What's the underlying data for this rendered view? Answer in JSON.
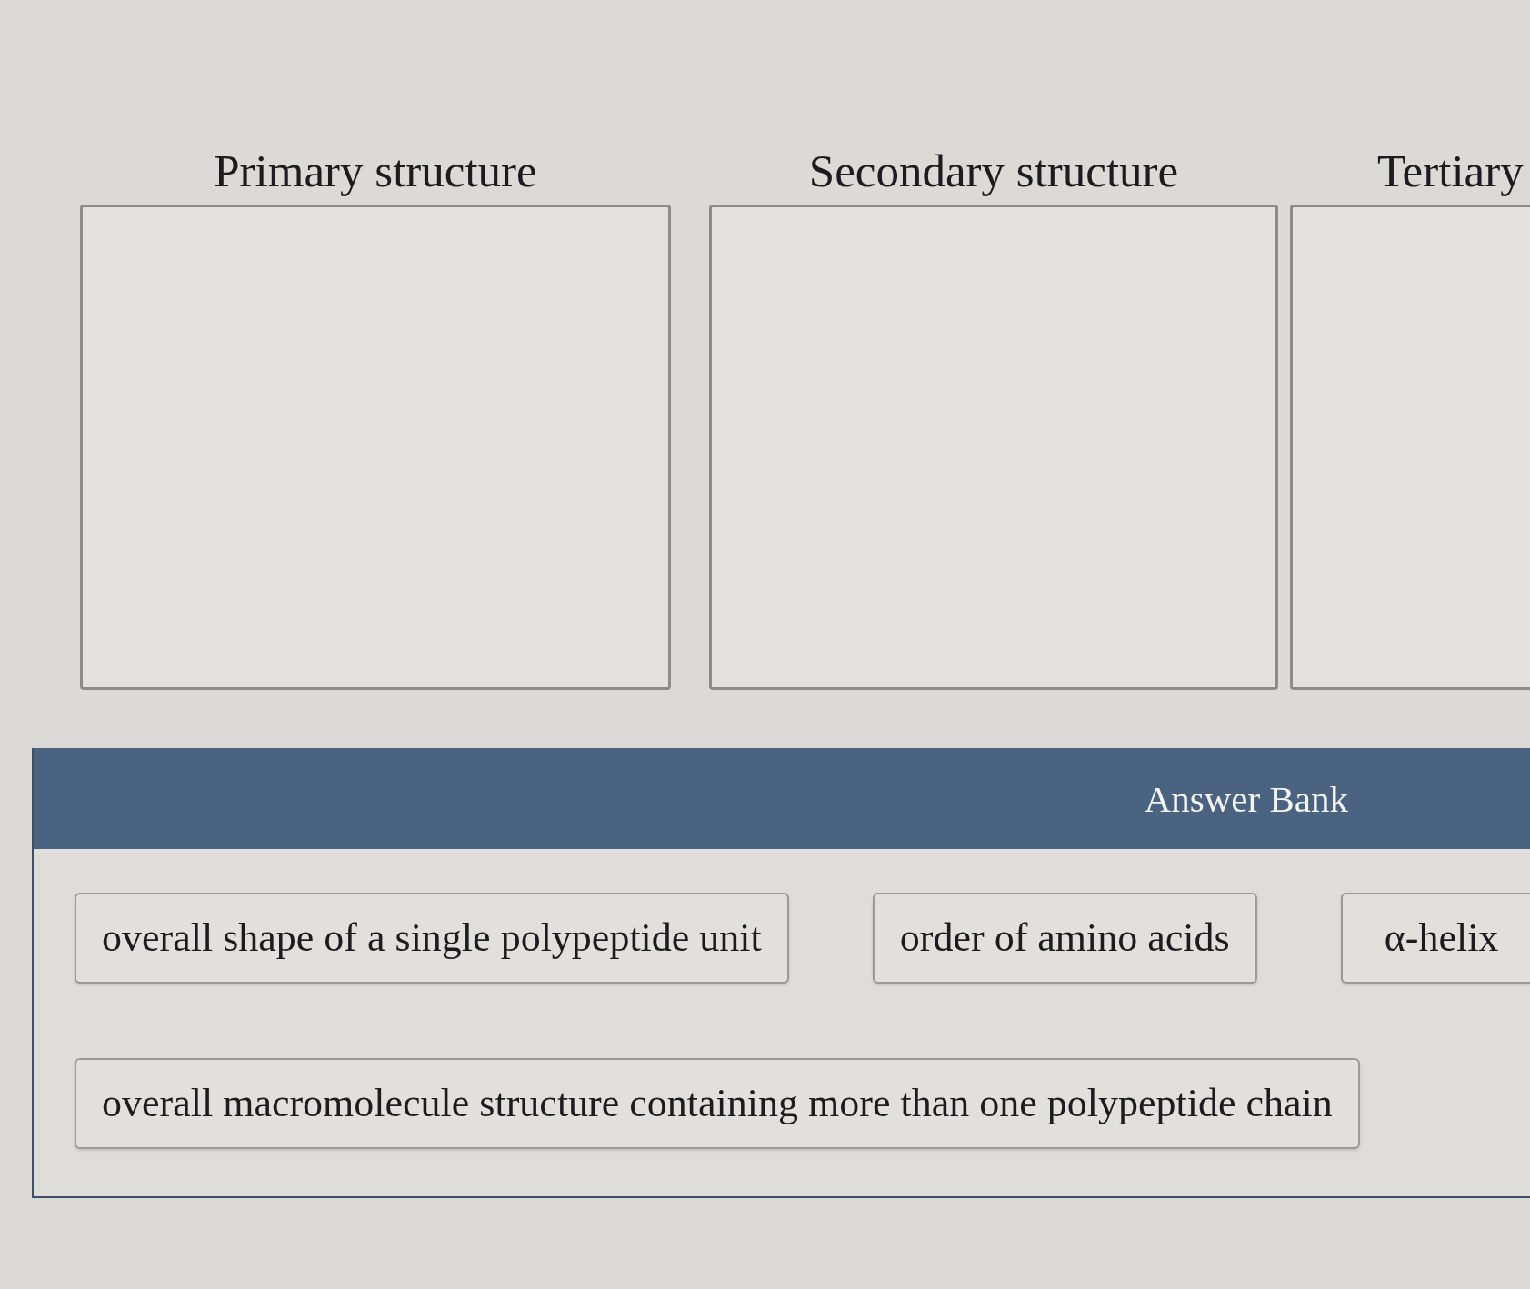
{
  "drop_targets": [
    {
      "label": "Primary structure"
    },
    {
      "label": "Secondary structure"
    },
    {
      "label": "Tertiary"
    }
  ],
  "answer_bank": {
    "title": "Answer Bank",
    "rows": [
      {
        "items": [
          {
            "text": "overall shape of a single polypeptide unit"
          },
          {
            "text": "order of amino acids"
          },
          {
            "text": "α-helix"
          }
        ]
      },
      {
        "items": [
          {
            "text": "overall macromolecule structure containing more than one polypeptide chain"
          }
        ]
      }
    ]
  }
}
